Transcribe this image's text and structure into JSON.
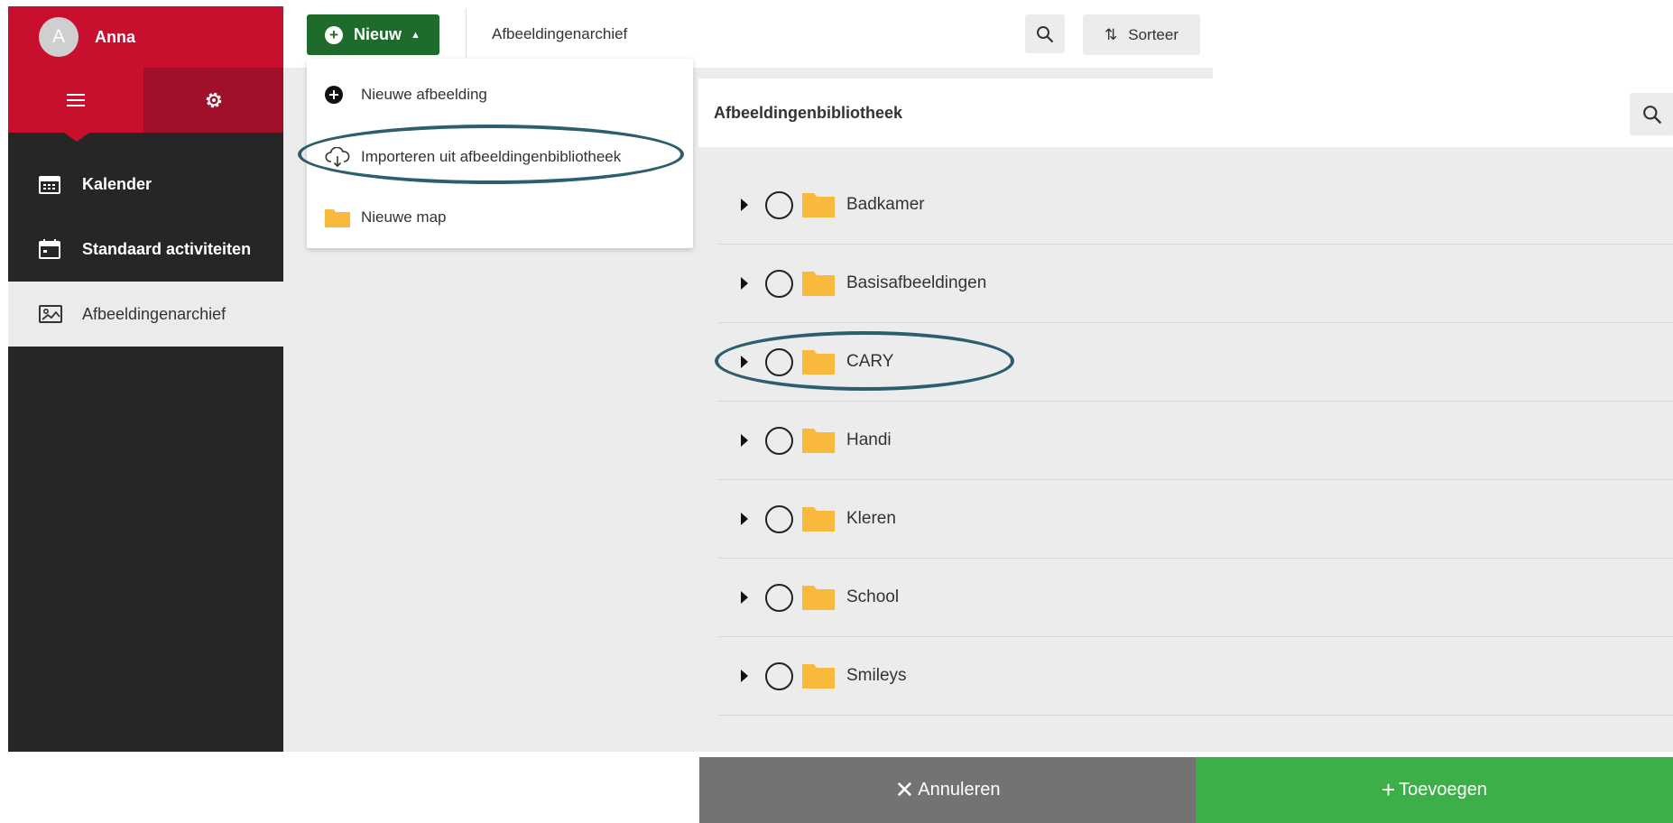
{
  "user": {
    "initial": "A",
    "name": "Anna"
  },
  "sidebar": {
    "items": [
      {
        "label": "Kalender",
        "icon": "calendar-grid-icon"
      },
      {
        "label": "Standaard activiteiten",
        "icon": "calendar-icon"
      },
      {
        "label": "Afbeeldingenarchief",
        "icon": "image-icon",
        "active": true
      }
    ]
  },
  "toolbar": {
    "new_label": "Nieuw",
    "breadcrumb": "Afbeeldingenarchief",
    "sort_label": "Sorteer"
  },
  "dropdown": {
    "items": [
      {
        "label": "Nieuwe afbeelding",
        "icon": "plus-circle-icon"
      },
      {
        "label": "Importeren uit afbeeldingenbibliotheek",
        "icon": "cloud-download-icon",
        "highlighted": true
      },
      {
        "label": "Nieuwe map",
        "icon": "folder-icon"
      }
    ]
  },
  "library": {
    "title": "Afbeeldingenbibliotheek",
    "folders": [
      "Badkamer",
      "Basisafbeeldingen",
      "CARY",
      "Handi",
      "Kleren",
      "School",
      "Smileys"
    ],
    "highlighted_folder": "CARY"
  },
  "actions": {
    "cancel_label": "Annuleren",
    "add_label": "Toevoegen"
  },
  "colors": {
    "brand_red": "#c8102e",
    "sidebar_dark": "#262626",
    "new_button_green": "#1e6b2b",
    "add_button_green": "#3caf49",
    "cancel_gray": "#737373",
    "folder_yellow": "#f9b93c",
    "highlight_ellipse": "#2d5e6e"
  }
}
